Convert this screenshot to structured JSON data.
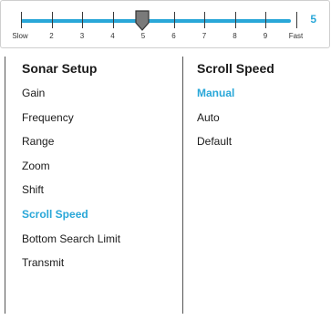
{
  "slider": {
    "value": 5,
    "value_label": "5",
    "min_label": "Slow",
    "max_label": "Fast",
    "tick_labels": [
      "Slow",
      "2",
      "3",
      "4",
      "5",
      "6",
      "7",
      "8",
      "9",
      "Fast"
    ],
    "accent_color": "#29a7d8",
    "thumb_icon": "pentagon-pointer-icon"
  },
  "left_menu": {
    "title": "Sonar Setup",
    "items": [
      {
        "label": "Gain",
        "selected": false
      },
      {
        "label": "Frequency",
        "selected": false
      },
      {
        "label": "Range",
        "selected": false
      },
      {
        "label": "Zoom",
        "selected": false
      },
      {
        "label": "Shift",
        "selected": false
      },
      {
        "label": "Scroll Speed",
        "selected": true
      },
      {
        "label": "Bottom Search Limit",
        "selected": false
      },
      {
        "label": "Transmit",
        "selected": false
      }
    ]
  },
  "right_menu": {
    "title": "Scroll Speed",
    "items": [
      {
        "label": "Manual",
        "selected": true
      },
      {
        "label": "Auto",
        "selected": false
      },
      {
        "label": "Default",
        "selected": false
      }
    ]
  }
}
